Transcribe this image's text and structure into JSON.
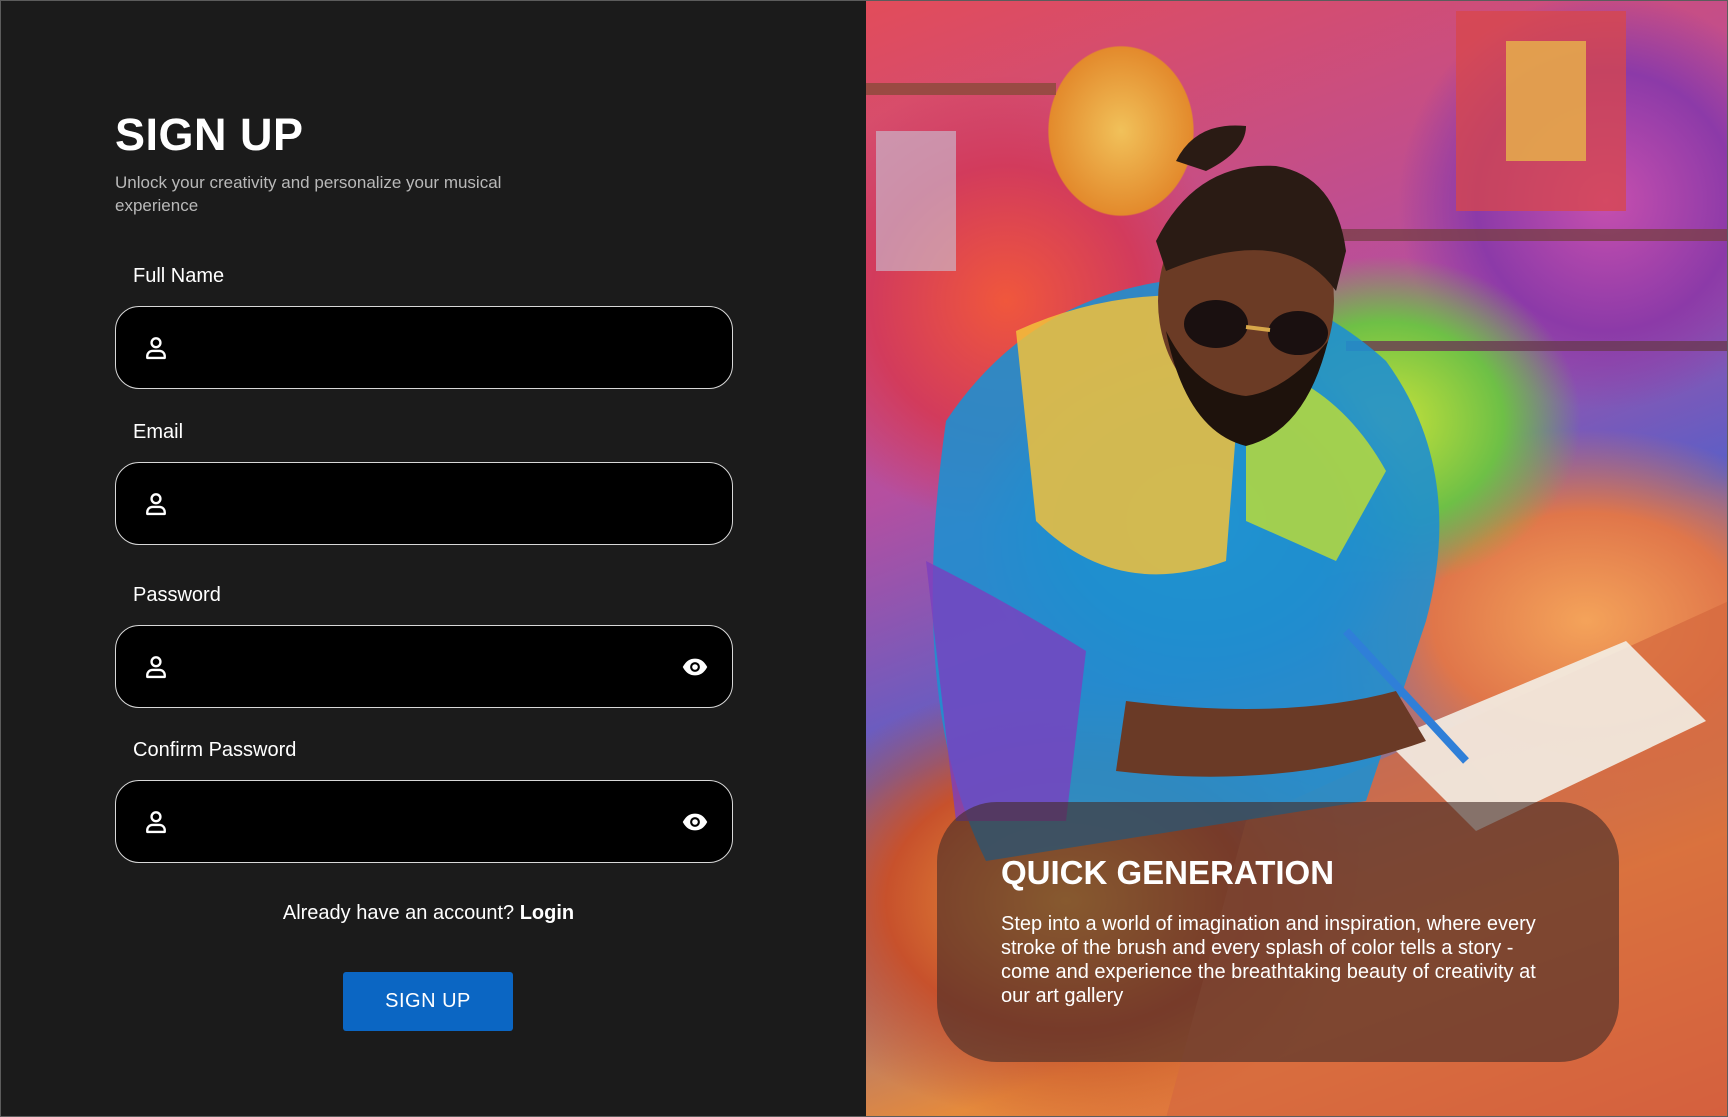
{
  "form": {
    "title": "SIGN UP",
    "subtitle": "Unlock your creativity and personalize your musical experience",
    "fields": [
      {
        "label": "Full Name",
        "value": "",
        "icon": "person-icon"
      },
      {
        "label": "Email",
        "value": "",
        "icon": "person-icon"
      },
      {
        "label": "Password",
        "value": "",
        "icon": "person-icon",
        "toggle_icon": "eye-icon"
      },
      {
        "label": "Confirm Password",
        "value": "",
        "icon": "person-icon",
        "toggle_icon": "eye-icon"
      }
    ],
    "login_prompt": "Already have an account?",
    "login_link": "Login",
    "submit_label": "SIGN UP"
  },
  "feature_card": {
    "title": "QUICK GENERATION",
    "text": "Step into a world of imagination and inspiration, where every stroke of the brush and every splash of color tells a story - come and experience the breathtaking beauty of creativity at our art gallery"
  },
  "colors": {
    "panel_background": "#1b1b1b",
    "input_background": "#000000",
    "input_border": "#d8d8d8",
    "button": "#0b66c3",
    "text": "#ffffff",
    "subtitle": "#b9b9b9"
  }
}
